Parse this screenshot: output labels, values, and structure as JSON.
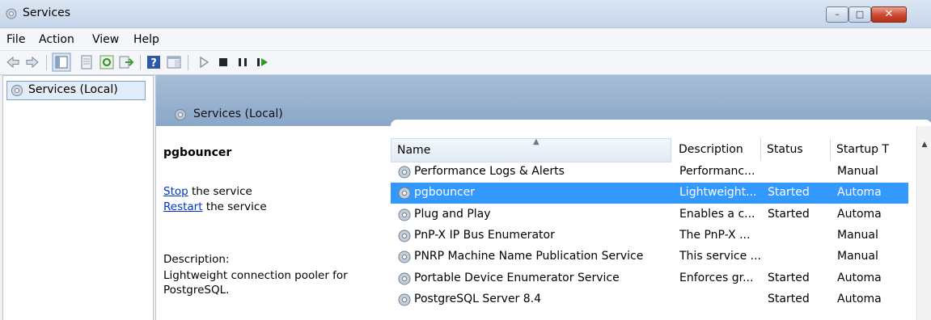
{
  "window": {
    "title": "Services"
  },
  "menu": [
    "File",
    "Action",
    "View",
    "Help"
  ],
  "left_pane": {
    "tree_item": "Services (Local)"
  },
  "right_pane": {
    "header": "Services (Local)",
    "detail": {
      "service_name": "pgbouncer",
      "stop_link": "Stop",
      "stop_suffix": " the service",
      "restart_link": "Restart",
      "restart_suffix": " the service",
      "description_label": "Description:",
      "description": "Lightweight connection pooler for PostgreSQL."
    },
    "columns": {
      "name": "Name",
      "description": "Description",
      "status": "Status",
      "startup": "Startup T"
    },
    "rows": [
      {
        "name": "Performance Logs & Alerts",
        "description": "Performanc...",
        "status": "",
        "startup": "Manual"
      },
      {
        "name": "pgbouncer",
        "description": "Lightweight...",
        "status": "Started",
        "startup": "Automa",
        "selected": true
      },
      {
        "name": "Plug and Play",
        "description": "Enables a c...",
        "status": "Started",
        "startup": "Automa"
      },
      {
        "name": "PnP-X IP Bus Enumerator",
        "description": "The PnP-X ...",
        "status": "",
        "startup": "Manual"
      },
      {
        "name": "PNRP Machine Name Publication Service",
        "description": "This service ...",
        "status": "",
        "startup": "Manual"
      },
      {
        "name": "Portable Device Enumerator Service",
        "description": "Enforces gr...",
        "status": "Started",
        "startup": "Automa"
      },
      {
        "name": "PostgreSQL Server 8.4",
        "description": "",
        "status": "Started",
        "startup": "Automa"
      }
    ]
  },
  "colors": {
    "selection": "#3399ff",
    "link": "#0033cc",
    "header_band": "#8aa7c8"
  }
}
